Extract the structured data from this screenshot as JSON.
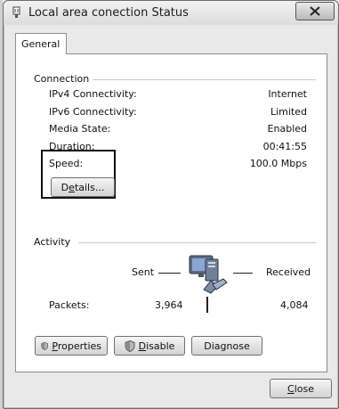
{
  "window": {
    "title": "Local area conection Status"
  },
  "tabs": [
    {
      "label": "General"
    }
  ],
  "connection": {
    "heading": "Connection",
    "rows": [
      {
        "label": "IPv4 Connectivity:",
        "value": "Internet"
      },
      {
        "label": "IPv6 Connectivity:",
        "value": "Limited"
      },
      {
        "label": "Media State:",
        "value": "Enabled"
      },
      {
        "label": "Duration:",
        "value": "00:41:55"
      },
      {
        "label": "Speed:",
        "value": "100.0 Mbps"
      }
    ],
    "details_button": {
      "pre": "D",
      "accel": "e",
      "post": "tails..."
    }
  },
  "activity": {
    "heading": "Activity",
    "sent_label": "Sent",
    "received_label": "Received",
    "packets_label": "Packets:",
    "packets_sent": "3,964",
    "packets_received": "4,084"
  },
  "buttons": {
    "properties": {
      "accel": "P",
      "rest": "roperties"
    },
    "disable": {
      "accel": "D",
      "rest": "isable"
    },
    "diagnose": {
      "label": "Diagnose"
    },
    "close": {
      "accel": "C",
      "rest": "lose"
    }
  },
  "icons": {
    "app": "network-adapter-icon",
    "network": "network-connection-icon",
    "shield": "uac-shield-icon",
    "close": "close-icon"
  }
}
